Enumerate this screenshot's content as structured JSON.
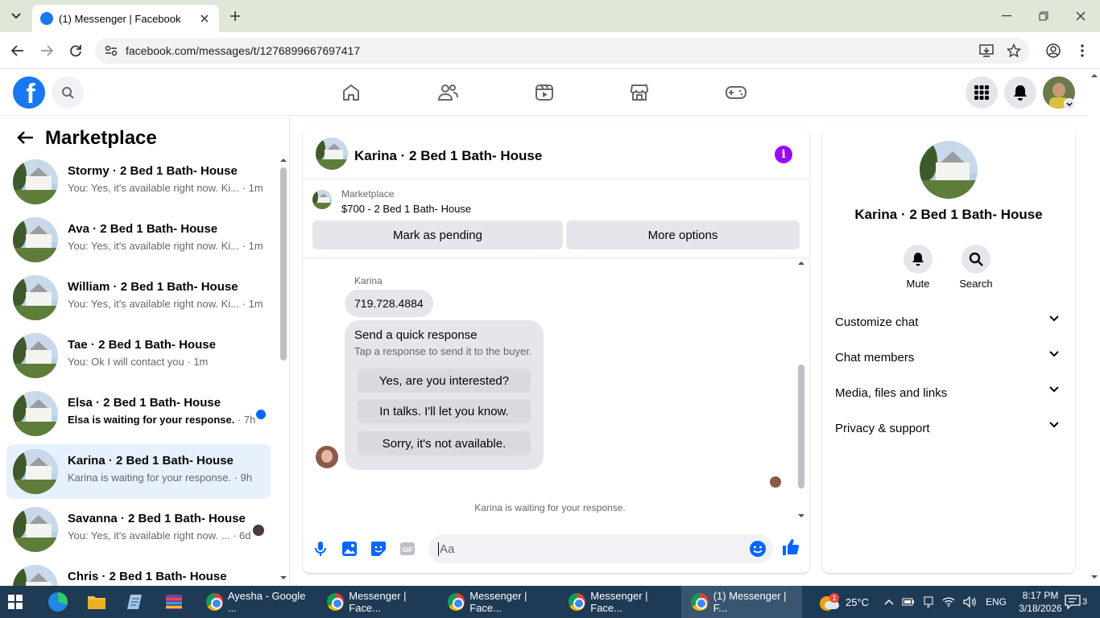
{
  "browser": {
    "tab_title": "(1) Messenger | Facebook",
    "url": "facebook.com/messages/t/1276899667697417"
  },
  "sidebar": {
    "title": "Marketplace",
    "conversations": [
      {
        "name": "Stormy · 2 Bed 1 Bath- House",
        "snippet": "You: Yes, it's available right now. Ki...",
        "time": "1m",
        "unread": false,
        "active": false
      },
      {
        "name": "Ava · 2 Bed 1 Bath- House",
        "snippet": "You: Yes, it's available right now. Ki...",
        "time": "1m",
        "unread": false,
        "active": false
      },
      {
        "name": "William · 2 Bed 1 Bath- House",
        "snippet": "You: Yes, it's available right now. Ki...",
        "time": "1m",
        "unread": false,
        "active": false
      },
      {
        "name": "Tae · 2 Bed 1 Bath- House",
        "snippet": "You: Ok I will contact you",
        "time": "1m",
        "unread": false,
        "active": false
      },
      {
        "name": "Elsa · 2 Bed 1 Bath- House",
        "snippet": "Elsa is waiting for your response.",
        "time": "7h",
        "unread": true,
        "active": false
      },
      {
        "name": "Karina · 2 Bed 1 Bath- House",
        "snippet": "Karina is waiting for your response.",
        "time": "9h",
        "unread": false,
        "active": true
      },
      {
        "name": "Savanna · 2 Bed 1 Bath- House",
        "snippet": "You: Yes, it's available right now. ...",
        "time": "6d",
        "unread": false,
        "active": false
      },
      {
        "name": "Chris · 2 Bed 1 Bath- House",
        "snippet": "",
        "time": "",
        "unread": false,
        "active": false
      }
    ]
  },
  "chat": {
    "title": "Karina · 2 Bed 1 Bath- House",
    "marketplace_label": "Marketplace",
    "listing": "$700 - 2 Bed 1 Bath- House",
    "mark_pending": "Mark as pending",
    "more_options": "More options",
    "sender": "Karina",
    "message": "719.728.4884",
    "quick_title": "Send a quick response",
    "quick_sub": "Tap a response to send it to the buyer.",
    "quick_options": [
      "Yes, are you interested?",
      "In talks. I'll let you know.",
      "Sorry, it's not available."
    ],
    "waiting": "Karina is waiting for your response.",
    "input_placeholder": "Aa"
  },
  "details": {
    "name": "Karina · 2 Bed 1 Bath- House",
    "mute": "Mute",
    "search": "Search",
    "sections": [
      "Customize chat",
      "Chat members",
      "Media, files and links",
      "Privacy & support"
    ]
  },
  "taskbar": {
    "items": [
      "Ayesha - Google ...",
      "Messenger | Face...",
      "Messenger | Face...",
      "Messenger | Face...",
      "(1) Messenger | F..."
    ],
    "weather": "25°C",
    "lang": "ENG",
    "time": "8:17 PM",
    "date": "3/18/2026",
    "notif_count": "3",
    "weather_badge": "1"
  },
  "colors": {
    "fb_blue": "#1877f2",
    "info_purple": "#9b0af0",
    "active_row": "#e7f1fd"
  }
}
